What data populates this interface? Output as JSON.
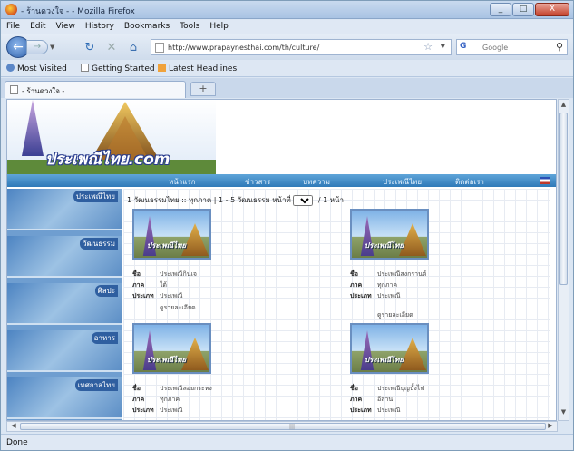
{
  "window": {
    "title": "- ร้านดวงใจ -  - Mozilla Firefox",
    "minimize": "_",
    "maximize": "□",
    "close": "X"
  },
  "menu": [
    "File",
    "Edit",
    "View",
    "History",
    "Bookmarks",
    "Tools",
    "Help"
  ],
  "url": "http://www.prapaynesthai.com/th/culture/",
  "search": {
    "engine": "G",
    "placeholder": "Google"
  },
  "bookmarks": [
    "Most Visited",
    "Getting Started",
    "Latest Headlines"
  ],
  "tab": {
    "label": "- ร้านดวงใจ -",
    "new_tab": "+"
  },
  "site": {
    "logo": "ประเพณีไทย.com",
    "nav": [
      "หน้าแรก",
      "ข่าวสาร",
      "บทความ",
      "ประเพณีไทย",
      "ติดต่อเรา"
    ],
    "sidebar": [
      "ประเพณีไทย",
      "วัฒนธรรม",
      "ศิลปะ",
      "อาหาร",
      "เทศกาลไทย"
    ],
    "pager": {
      "text": "1 วัฒนธรรมไทย :: ทุกภาค  |  1 - 5 วัฒนธรรม  หน้าที่",
      "page": "1",
      "total": "/ 1 หน้า"
    },
    "field_labels": {
      "name": "ชื่อ",
      "region": "ภาค",
      "category": "ประเภท"
    },
    "items": [
      {
        "image_text": "ประเพณีไทย",
        "name": "ประเพณีกินเจ",
        "region": "ใต้",
        "category": "ประเพณี",
        "caption": "ดูรายละเอียด"
      },
      {
        "image_text": "ประเพณีไทย",
        "name": "ประเพณีสงกรานต์",
        "region": "ทุกภาค",
        "category": "ประเพณี",
        "caption": "ดูรายละเอียด"
      },
      {
        "image_text": "ประเพณีไทย",
        "name": "ประเพณีลอยกระทง",
        "region": "ทุกภาค",
        "category": "ประเพณี",
        "caption": ""
      },
      {
        "image_text": "ประเพณีไทย",
        "name": "ประเพณีบุญบั้งไฟ",
        "region": "อีสาน",
        "category": "ประเพณี",
        "caption": ""
      }
    ]
  },
  "status": "Done",
  "colors": {
    "accent": "#2f79b8",
    "sidebar": "#6f9ed0"
  }
}
